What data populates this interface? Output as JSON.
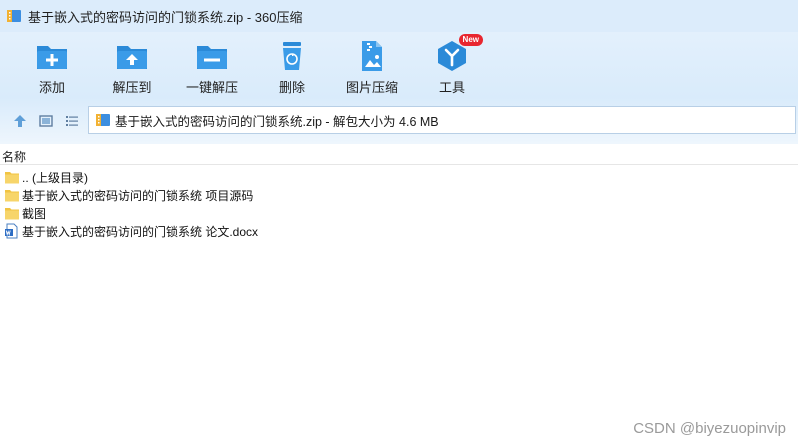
{
  "window": {
    "title": "基于嵌入式的密码访问的门锁系统.zip - 360压缩",
    "icon": "archive-icon"
  },
  "toolbar": {
    "items": [
      {
        "label": "添加",
        "icon": "add-icon"
      },
      {
        "label": "解压到",
        "icon": "extract-to-icon"
      },
      {
        "label": "一键解压",
        "icon": "one-click-extract-icon"
      },
      {
        "label": "删除",
        "icon": "delete-icon"
      },
      {
        "label": "图片压缩",
        "icon": "image-compress-icon"
      },
      {
        "label": "工具",
        "icon": "tools-icon",
        "badge": "New"
      }
    ],
    "accent": "#2b8ad8"
  },
  "address": {
    "text": "基于嵌入式的密码访问的门锁系统.zip - 解包大小为 4.6 MB"
  },
  "columns": {
    "name": "名称"
  },
  "files": [
    {
      "name": ".. (上级目录)",
      "icon": "folder-icon"
    },
    {
      "name": "基于嵌入式的密码访问的门锁系统 项目源码",
      "icon": "folder-icon"
    },
    {
      "name": "截图",
      "icon": "folder-icon"
    },
    {
      "name": "基于嵌入式的密码访问的门锁系统 论文.docx",
      "icon": "word-doc-icon"
    }
  ],
  "watermark": "CSDN @biyezuopinvip"
}
